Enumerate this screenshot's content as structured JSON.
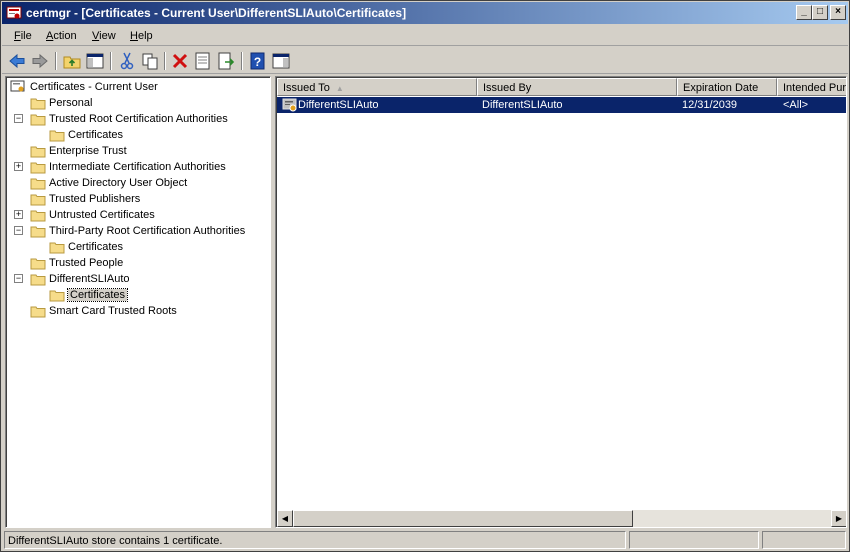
{
  "window": {
    "title": "certmgr - [Certificates - Current User\\DifferentSLIAuto\\Certificates]",
    "minimize_glyph": "_",
    "maximize_glyph": "□",
    "close_glyph": "×"
  },
  "menu": {
    "file": {
      "ul": "F",
      "rest": "ile"
    },
    "action": {
      "ul": "A",
      "rest": "ction"
    },
    "view": {
      "ul": "V",
      "rest": "iew"
    },
    "help": {
      "ul": "H",
      "rest": "elp"
    }
  },
  "toolbar": {
    "icons": [
      "back-icon",
      "forward-icon",
      "up-folder-icon",
      "show-hide-tree-icon",
      "cut-icon",
      "copy-icon",
      "delete-icon",
      "properties-icon",
      "export-icon",
      "help-icon",
      "show-hide-action-pane-icon"
    ]
  },
  "tree": {
    "root": "Certificates - Current User",
    "personal": "Personal",
    "trusted_root": "Trusted Root Certification Authorities",
    "trusted_root_certs": "Certificates",
    "enterprise_trust": "Enterprise Trust",
    "intermediate": "Intermediate Certification Authorities",
    "active_directory": "Active Directory User Object",
    "trusted_publishers": "Trusted Publishers",
    "untrusted": "Untrusted Certificates",
    "third_party_root": "Third-Party Root Certification Authorities",
    "third_party_certs": "Certificates",
    "trusted_people": "Trusted People",
    "different_sli": "DifferentSLIAuto",
    "different_sli_certs": "Certificates",
    "smart_card": "Smart Card Trusted Roots",
    "expanded_glyph": "−",
    "collapsed_glyph": "+"
  },
  "list": {
    "columns": [
      "Issued To",
      "Issued By",
      "Expiration Date",
      "Intended Pur"
    ],
    "rows": [
      {
        "issued_to": "DifferentSLIAuto",
        "issued_by": "DifferentSLIAuto",
        "expiration": "12/31/2039",
        "purposes": "<All>"
      }
    ],
    "sort_glyph": "▲",
    "scroll_left_glyph": "◀",
    "scroll_right_glyph": "▶"
  },
  "status": {
    "text": "DifferentSLIAuto store contains 1 certificate."
  },
  "colors": {
    "selection": "#0a246a",
    "title_gradient_start": "#0a246a",
    "title_gradient_end": "#a6caf0",
    "chrome": "#d4d0c8"
  }
}
